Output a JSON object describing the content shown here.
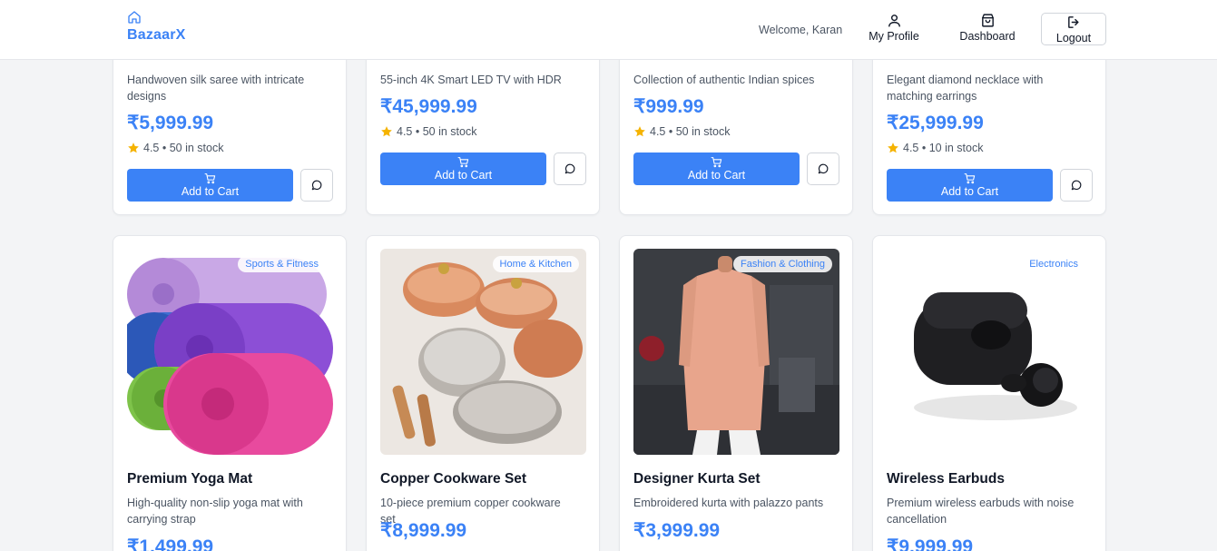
{
  "header": {
    "brand": "BazaarX",
    "welcome": "Welcome, Karan",
    "nav": {
      "profile": "My Profile",
      "dashboard": "Dashboard",
      "logout": "Logout"
    }
  },
  "colors": {
    "accent": "#3b82f6",
    "star": "#f5b301"
  },
  "products_top": [
    {
      "description": "Handwoven silk saree with intricate designs",
      "price": "₹5,999.99",
      "rating_text": "4.5 • 50 in stock",
      "cart_label": "Add to Cart"
    },
    {
      "description": "55-inch 4K Smart LED TV with HDR",
      "price": "₹45,999.99",
      "rating_text": "4.5 • 50 in stock",
      "cart_label": "Add to Cart"
    },
    {
      "description": "Collection of authentic Indian spices",
      "price": "₹999.99",
      "rating_text": "4.5 • 50 in stock",
      "cart_label": "Add to Cart"
    },
    {
      "description": "Elegant diamond necklace with matching earrings",
      "price": "₹25,999.99",
      "rating_text": "4.5 • 10 in stock",
      "cart_label": "Add to Cart"
    }
  ],
  "products_bottom": [
    {
      "category": "Sports & Fitness",
      "name": "Premium Yoga Mat",
      "description": "High-quality non-slip yoga mat with carrying strap",
      "price": "₹1,499.99",
      "image": "yoga-mat-image"
    },
    {
      "category": "Home & Kitchen",
      "name": "Copper Cookware Set",
      "description": "10-piece premium copper cookware set",
      "price": "₹8,999.99",
      "image": "cookware-image"
    },
    {
      "category": "Fashion & Clothing",
      "name": "Designer Kurta Set",
      "description": "Embroidered kurta with palazzo pants",
      "price": "₹3,999.99",
      "image": "kurta-image"
    },
    {
      "category": "Electronics",
      "name": "Wireless Earbuds",
      "description": "Premium wireless earbuds with noise cancellation",
      "price": "₹9,999.99",
      "image": "earbuds-image"
    }
  ]
}
